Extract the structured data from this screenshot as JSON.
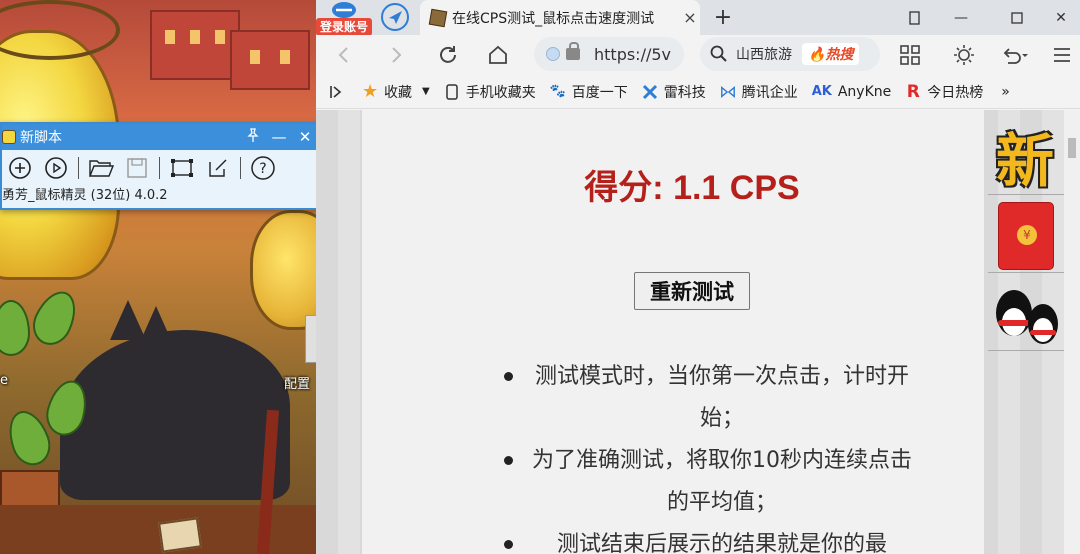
{
  "desktop": {
    "label_left": "e",
    "label_right": "配置"
  },
  "tool_window": {
    "title": "新脚本",
    "status": "勇芳_鼠标精灵 (32位) 4.0.2",
    "icons": [
      "add-icon",
      "play-icon",
      "open-folder-icon",
      "save-icon",
      "capture-region-icon",
      "edit-icon",
      "help-icon"
    ]
  },
  "browser": {
    "login_badge": "登录账号",
    "tab_title": "在线CPS测试_鼠标点击速度测试",
    "tab_close": "×",
    "new_tab": "+",
    "url": "https://5v",
    "search_text": "山西旅游",
    "search_hot": "热搜",
    "bookmarks": [
      {
        "label": "收藏",
        "icon": "star-icon"
      },
      {
        "label": "手机收藏夹",
        "icon": "phone-icon"
      },
      {
        "label": "百度一下",
        "icon": "baidu-icon"
      },
      {
        "label": "雷科技",
        "icon": "leikeji-icon"
      },
      {
        "label": "腾讯企业",
        "icon": "tencent-icon"
      },
      {
        "label": "AnyKne",
        "icon": "ak-icon",
        "prefix": "AK"
      },
      {
        "label": "今日热榜",
        "icon": "r-icon",
        "prefix": "R"
      }
    ],
    "bookmarks_more": "»"
  },
  "page": {
    "score_label": "得分: 1.1 CPS",
    "retest_button": "重新测试",
    "rules": [
      "测试模式时，当你第一次点击，计时开始；",
      "为了准确测试，将取你10秒内连续点击的平均值；",
      "测试结束后展示的结果就是你的最"
    ],
    "side_new": "新",
    "red_packet_symbol": "¥"
  },
  "colors": {
    "score": "#b5201a",
    "tab_strip": "#dee1e6",
    "tool_title": "#3c8fdb",
    "login_badge": "#e84a3a"
  }
}
